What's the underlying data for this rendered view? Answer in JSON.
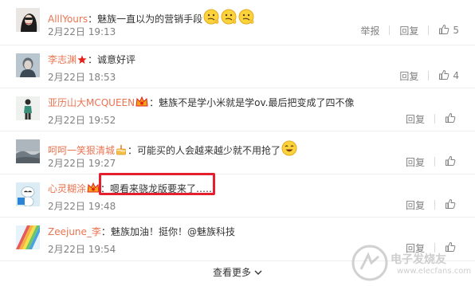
{
  "comments": [
    {
      "name": "AlllYours",
      "sep": "：",
      "text": "魅族一直以为的营销手段",
      "time": "2月22日 19:13",
      "report": "举报",
      "reply": "回复",
      "likes": "5"
    },
    {
      "name": "李志渊",
      "sep": "：",
      "text": "诚意好评",
      "time": "2月22日 18:53",
      "reply": "回复",
      "likes": "4"
    },
    {
      "name": "亚历山大MCQUEEN",
      "sep": "：",
      "text": "魅族不是学小米就是学ov.最后把变成了四不像",
      "time": "2月22日 19:52",
      "reply": "回复",
      "likes": ""
    },
    {
      "name": "呵呵一笑狠清城",
      "sep": "：",
      "text": "可能买的人会越来越少就不用抢了",
      "time": "2月22日 19:27",
      "reply": "回复",
      "likes": ""
    },
    {
      "name": "心灵糊涂",
      "sep": "：",
      "text": "嗯看来骁龙版要来了……",
      "time": "2月22日 19:48",
      "reply": "回复",
      "likes": ""
    },
    {
      "name": "Zeejune_李",
      "sep": "：",
      "text": "魅族加油！挺你！@魅族科技",
      "time": "2月22日 19:54",
      "reply": "回复",
      "likes": ""
    }
  ],
  "more_label": "查看更多",
  "watermark": {
    "text": "电子发烧友",
    "url": "www.elecfans.com"
  },
  "colors": {
    "name": "#eb7350",
    "meta": "#808080",
    "highlight": "#e5202e"
  }
}
